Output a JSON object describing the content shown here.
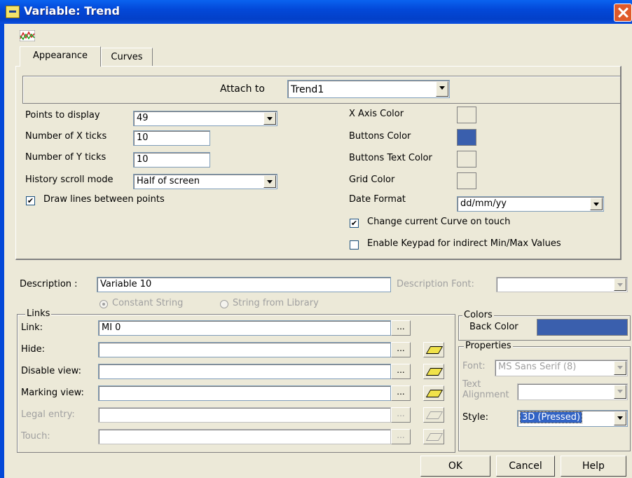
{
  "window": {
    "title": "Variable: Trend",
    "colors": {
      "titlebar": "#0348d8",
      "buttons_color": "#3a5fad",
      "back_color": "#3a5fad"
    }
  },
  "icons": {
    "title": "variable-window-icon",
    "trend": "trend-chart-icon",
    "close": "close-icon",
    "eraser": "eraser-icon"
  },
  "tabs": [
    {
      "label": "Appearance"
    },
    {
      "label": "Curves"
    }
  ],
  "appearance": {
    "attach_label": "Attach to",
    "attach_value": "Trend1",
    "points_label": "Points to display",
    "points_value": "49",
    "xticks_label": "Number of X ticks",
    "xticks_value": "10",
    "yticks_label": "Number of Y ticks",
    "yticks_value": "10",
    "history_label": "History scroll mode",
    "history_value": "Half of screen",
    "draw_lines_label": "Draw lines between points",
    "draw_lines_checked": true,
    "xaxis_color_label": "X Axis Color",
    "buttons_color_label": "Buttons Color",
    "buttons_text_color_label": "Buttons Text Color",
    "grid_color_label": "Grid Color",
    "date_format_label": "Date Format",
    "date_format_value": "dd/mm/yy",
    "change_curve_label": "Change current Curve on touch",
    "change_curve_checked": true,
    "keypad_label": "Enable Keypad for indirect Min/Max Values",
    "keypad_checked": false
  },
  "description": {
    "label": "Description :",
    "value": "Variable 10",
    "font_label": "Description Font:",
    "constant_label": "Constant String",
    "library_label": "String from Library"
  },
  "links": {
    "title": "Links",
    "link_label": "Link:",
    "link_value": "MI 0",
    "hide_label": "Hide:",
    "disable_label": "Disable view:",
    "marking_label": "Marking view:",
    "legal_label": "Legal entry:",
    "touch_label": "Touch:",
    "browse": "..."
  },
  "colors_group": {
    "title": "Colors",
    "back_color_label": "Back Color"
  },
  "properties": {
    "title": "Properties",
    "font_label": "Font:",
    "font_value": "MS Sans Serif (8)",
    "text_label": "Text",
    "alignment_label": "Alignment",
    "style_label": "Style:",
    "style_value": "3D (Pressed)"
  },
  "buttons": {
    "ok": "OK",
    "cancel": "Cancel",
    "help": "Help"
  }
}
